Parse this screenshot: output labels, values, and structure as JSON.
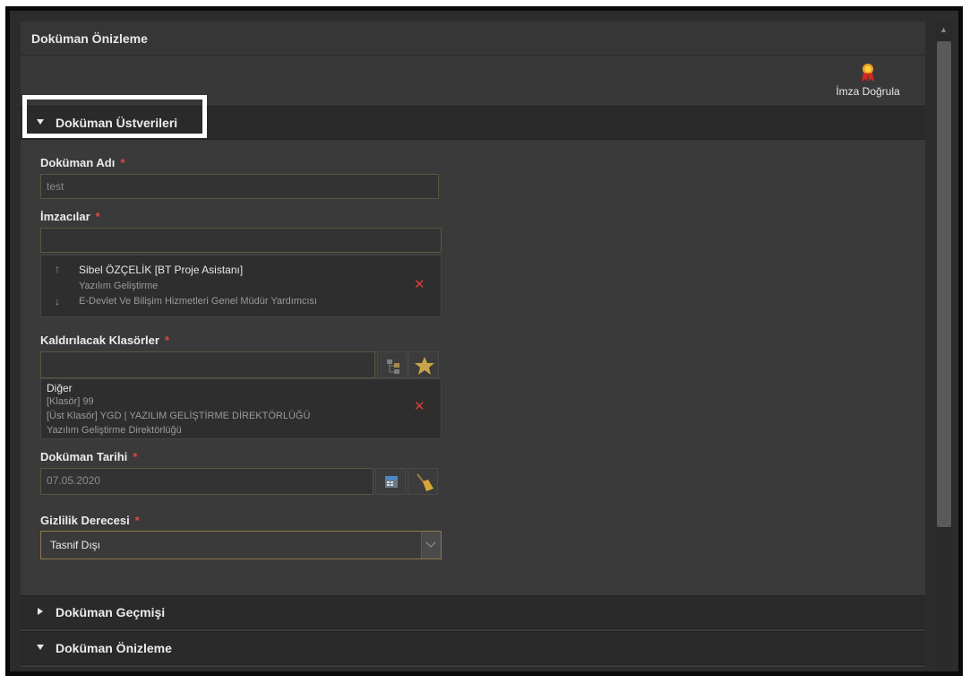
{
  "window": {
    "title": "Doküman Önizleme"
  },
  "toolbar": {
    "verify_label": "İmza Doğrula",
    "verify_icon": "award-ribbon-icon"
  },
  "sections": {
    "metadata": "Doküman Üstverileri",
    "history": "Doküman Geçmişi",
    "preview": "Doküman Önizleme"
  },
  "form": {
    "doc_name": {
      "label": "Doküman Adı",
      "required": "*",
      "value": "test"
    },
    "signers": {
      "label": "İmzacılar",
      "required": "*",
      "value": "",
      "items": [
        {
          "name": "Sibel ÖZÇELİK [BT Proje Asistanı]",
          "unit": "Yazılım Geliştirme",
          "dept": "E-Devlet Ve Bilişim Hizmetleri Genel Müdür Yardımcısı"
        }
      ]
    },
    "folders": {
      "label": "Kaldırılacak Klasörler",
      "required": "*",
      "value": "",
      "items": [
        {
          "name": "Diğer",
          "folder": "[Klasör] 99",
          "parent": "[Üst Klasör] YGD | YAZILIM GELİŞTİRME DİREKTÖRLÜĞÜ",
          "unit": "Yazılım Geliştirme Direktörlüğü"
        }
      ]
    },
    "doc_date": {
      "label": "Doküman Tarihi",
      "required": "*",
      "value": "07.05.2020"
    },
    "privacy": {
      "label": "Gizlilik Derecesi",
      "required": "*",
      "value": "Tasnif Dışı"
    }
  },
  "colors": {
    "accent": "#e04a3a",
    "panel": "#3a3a3a",
    "header": "#2a2a2a"
  }
}
